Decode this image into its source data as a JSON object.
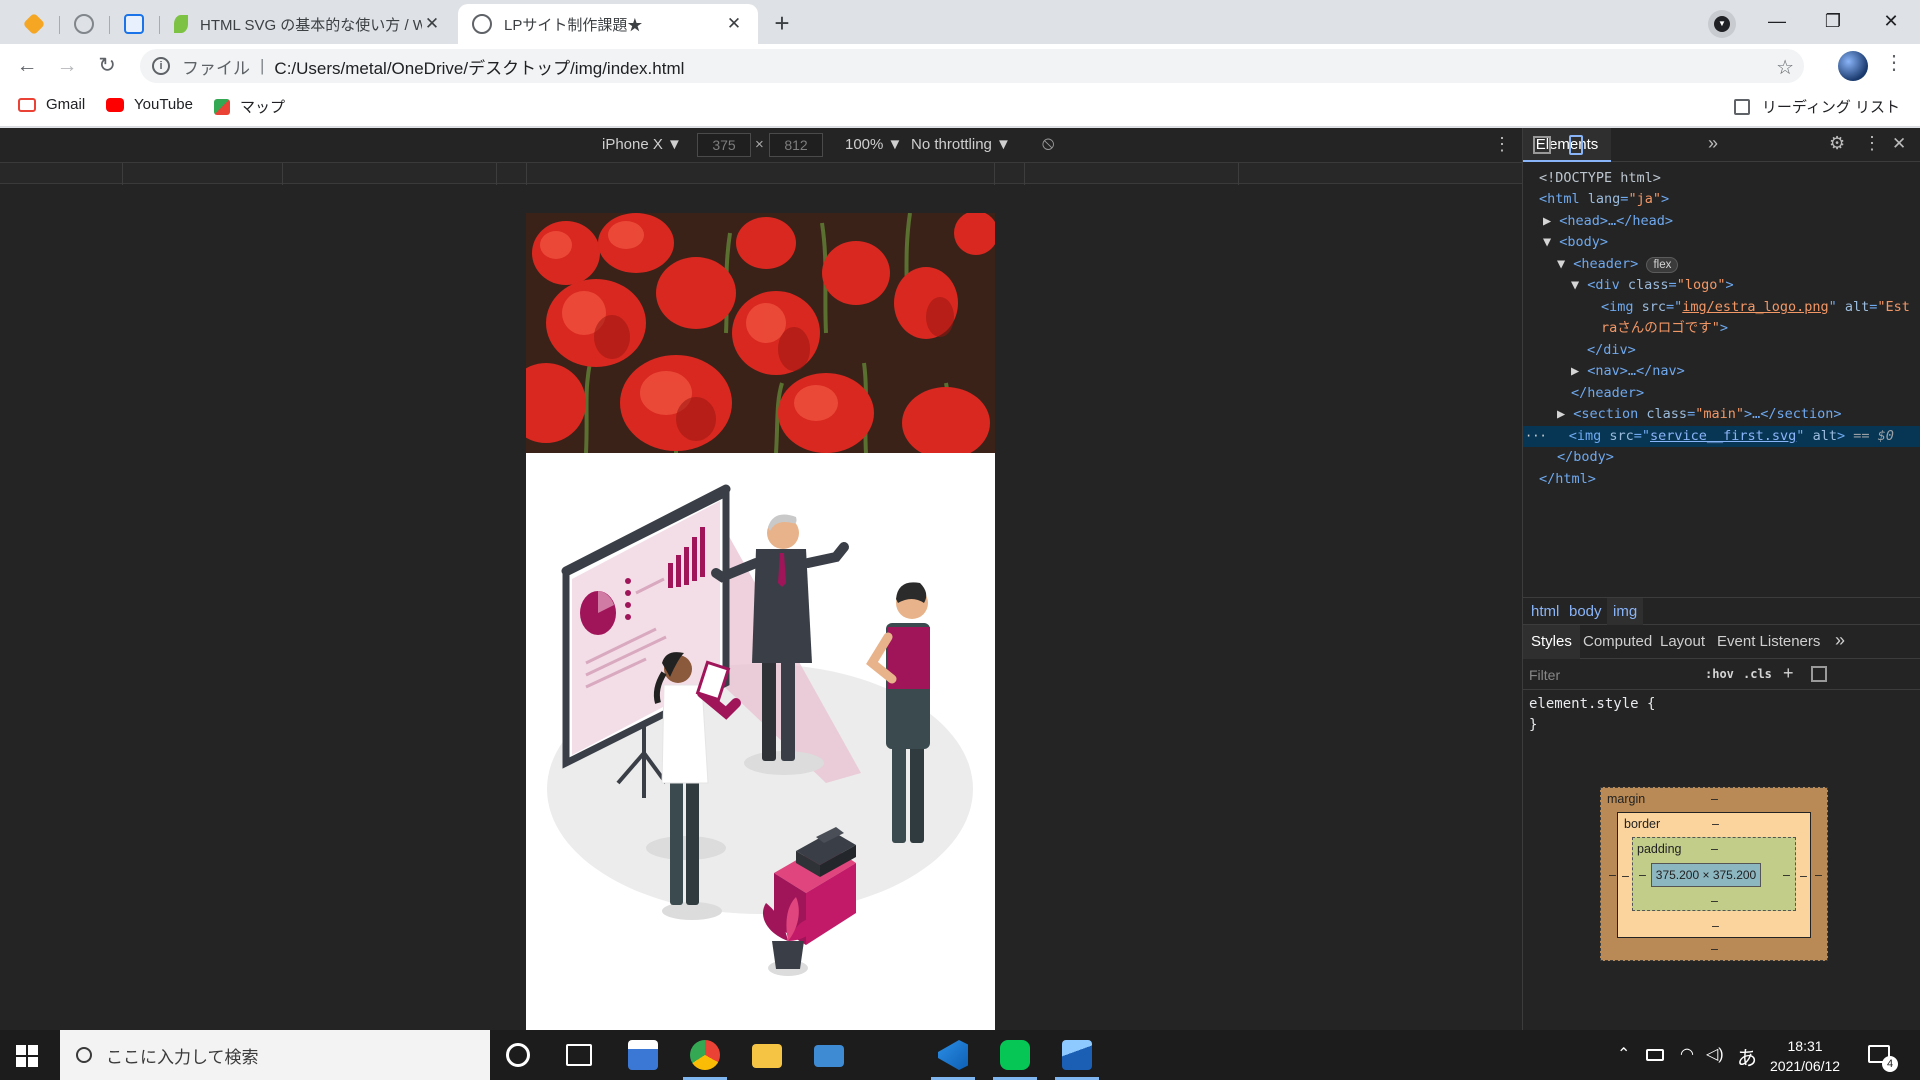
{
  "tabs": [
    {
      "title": "HTML SVG の基本的な使い方 / We",
      "close": "✕"
    },
    {
      "title": "LPサイト制作課題★",
      "close": "✕"
    }
  ],
  "newtab": "+",
  "window": {
    "minimize": "—",
    "maximize": "❐",
    "close": "✕"
  },
  "nav": {
    "back": "←",
    "forward": "→",
    "reload": "↻"
  },
  "omnibox": {
    "info": "i",
    "scheme": "ファイル",
    "divider": "|",
    "url": "C:/Users/metal/OneDrive/デスクトップ/img/index.html",
    "star": "☆"
  },
  "menu": "⋮",
  "bookmarks": [
    {
      "label": "Gmail",
      "color": "#ea4335"
    },
    {
      "label": "YouTube",
      "color": "#ff0000"
    },
    {
      "label": "マップ",
      "color": "#34a853"
    }
  ],
  "reading_list": "リーディング リスト",
  "device_toolbar": {
    "device": "iPhone X ▼",
    "width": "375",
    "times": "×",
    "height": "812",
    "zoom": "100% ▼",
    "throttling": "No throttling ▼",
    "rotate": "⦸",
    "more": "⋮"
  },
  "devtools": {
    "tab_elements": "Elements",
    "more_tabs": "»",
    "settings": "⚙",
    "kebab": "⋮",
    "close": "✕",
    "tree": {
      "doctype": "<!DOCTYPE html>",
      "html_open": "<html ",
      "lang_attr": "lang",
      "lang_val": "\"ja\"",
      "head": "<head>…</head>",
      "body_open": "<body>",
      "header_open": "<header>",
      "flex_badge": "flex",
      "div_open": "<div ",
      "class_attr": "class",
      "logo_val": "\"logo\"",
      "img_open": "<img ",
      "src_attr": "src",
      "logo_src": "img/estra_logo.png",
      "alt_attr": "alt",
      "alt_val_1": "\"Est",
      "alt_val_2": "raさんのロゴです\"",
      "div_close": "</div>",
      "nav": "<nav>…</nav>",
      "header_close": "</header>",
      "section_open": "<section ",
      "main_val": "\"main\"",
      "section_rest": ">…</section>",
      "svg_src": "service__first.svg",
      "sel_marker": "== $0",
      "dots": "···",
      "body_close": "</body>",
      "html_close": "</html>"
    },
    "breadcrumbs": [
      "html",
      "body",
      "img"
    ],
    "subtabs": [
      "Styles",
      "Computed",
      "Layout",
      "Event Listeners",
      "»"
    ],
    "filter": {
      "placeholder": "Filter",
      "hov": ":hov",
      "cls": ".cls",
      "add": "+"
    },
    "element_style": [
      "element.style {",
      "}"
    ],
    "box_model": {
      "margin": "margin",
      "border": "border",
      "padding": "padding",
      "dash": "–",
      "content": "375.200 × 375.200"
    }
  },
  "taskbar": {
    "search_placeholder": "ここに入力して検索",
    "time": "18:31",
    "date": "2021/06/12",
    "ime": "あ",
    "notifications": "4"
  }
}
